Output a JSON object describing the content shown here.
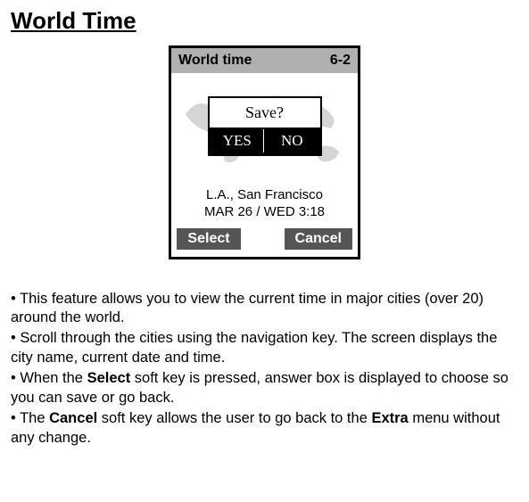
{
  "title": "World Time",
  "screen": {
    "header_title": "World time",
    "header_num": "6-2",
    "dialog": {
      "prompt": "Save?",
      "yes": "YES",
      "no": "NO"
    },
    "city": "L.A., San Francisco",
    "datetime": "MAR 26 / WED   3:18",
    "softkey_left": "Select",
    "softkey_right": "Cancel"
  },
  "paragraphs": {
    "p1": "• This feature allows you to view the current time in major cities (over 20) around the world.",
    "p2": "• Scroll through the cities using the navigation key. The screen displays the city name, current date and time.",
    "p3a": "• When the ",
    "p3b": "Select",
    "p3c": " soft key is pressed, answer box is displayed to choose so you can save or go back.",
    "p4a": "• The ",
    "p4b": "Cancel",
    "p4c": " soft key allows the user to go back to the ",
    "p4d": "Extra",
    "p4e": " menu without any change."
  }
}
